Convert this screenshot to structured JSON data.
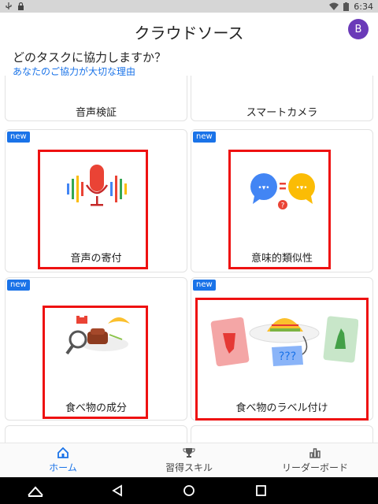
{
  "status_bar": {
    "time": "6:34"
  },
  "app_bar": {
    "title": "クラウドソース",
    "avatar_letter": "B"
  },
  "prompt": {
    "question": "どのタスクに協力しますか？",
    "why_link": "あなたのご協力が大切な理由"
  },
  "tasks": [
    {
      "label": "音声検証",
      "new": false
    },
    {
      "label": "スマートカメラ",
      "new": false
    },
    {
      "label": "音声の寄付",
      "new": true,
      "badge": "new"
    },
    {
      "label": "意味的類似性",
      "new": true,
      "badge": "new"
    },
    {
      "label": "食べ物の成分",
      "new": true,
      "badge": "new"
    },
    {
      "label": "食べ物のラベル付け",
      "new": true,
      "badge": "new"
    }
  ],
  "illustrations": {
    "semantic_bubble_text": "•▾•",
    "food_label_question": "???"
  },
  "bottom_nav": [
    {
      "label": "ホーム",
      "icon": "home-icon",
      "active": true
    },
    {
      "label": "習得スキル",
      "icon": "trophy-icon",
      "active": false
    },
    {
      "label": "リーダーボード",
      "icon": "bar-chart-icon",
      "active": false
    }
  ],
  "colors": {
    "accent": "#1a73e8",
    "highlight": "#ee1111",
    "avatar": "#6a3ab8"
  }
}
